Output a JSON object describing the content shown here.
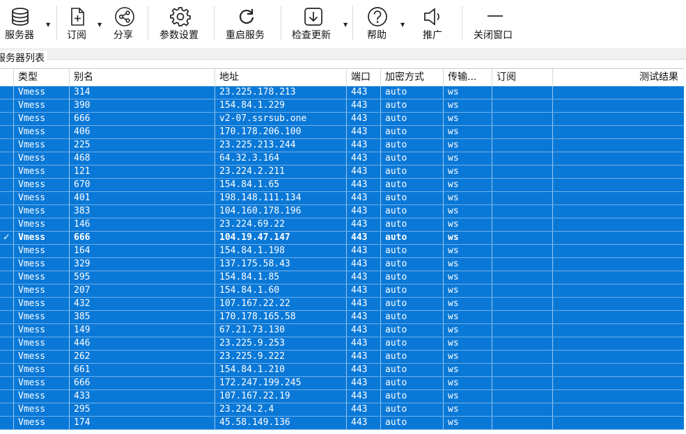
{
  "toolbar": {
    "servers": "服务器",
    "subscribe": "订阅",
    "share": "分享",
    "settings": "参数设置",
    "restart": "重启服务",
    "update": "检查更新",
    "help": "帮助",
    "promote": "推广",
    "close": "关闭窗口"
  },
  "group_label": "服务器列表",
  "columns": {
    "type": "类型",
    "alias": "别名",
    "address": "地址",
    "port": "端口",
    "security": "加密方式",
    "network": "传输...",
    "subscription": "订阅",
    "test": "测试结果"
  },
  "active_mark": "✓",
  "rows": [
    {
      "type": "Vmess",
      "alias": "314",
      "address": "23.225.178.213",
      "port": "443",
      "security": "auto",
      "network": "ws"
    },
    {
      "type": "Vmess",
      "alias": "390",
      "address": "154.84.1.229",
      "port": "443",
      "security": "auto",
      "network": "ws"
    },
    {
      "type": "Vmess",
      "alias": "666",
      "address": "v2-07.ssrsub.one",
      "port": "443",
      "security": "auto",
      "network": "ws"
    },
    {
      "type": "Vmess",
      "alias": "406",
      "address": "170.178.206.100",
      "port": "443",
      "security": "auto",
      "network": "ws"
    },
    {
      "type": "Vmess",
      "alias": "225",
      "address": "23.225.213.244",
      "port": "443",
      "security": "auto",
      "network": "ws"
    },
    {
      "type": "Vmess",
      "alias": "468",
      "address": "64.32.3.164",
      "port": "443",
      "security": "auto",
      "network": "ws"
    },
    {
      "type": "Vmess",
      "alias": "121",
      "address": "23.224.2.211",
      "port": "443",
      "security": "auto",
      "network": "ws"
    },
    {
      "type": "Vmess",
      "alias": "670",
      "address": "154.84.1.65",
      "port": "443",
      "security": "auto",
      "network": "ws"
    },
    {
      "type": "Vmess",
      "alias": "401",
      "address": "198.148.111.134",
      "port": "443",
      "security": "auto",
      "network": "ws"
    },
    {
      "type": "Vmess",
      "alias": "383",
      "address": "104.160.178.196",
      "port": "443",
      "security": "auto",
      "network": "ws"
    },
    {
      "type": "Vmess",
      "alias": "146",
      "address": "23.224.69.22",
      "port": "443",
      "security": "auto",
      "network": "ws"
    },
    {
      "type": "Vmess",
      "alias": "666",
      "address": "104.19.47.147",
      "port": "443",
      "security": "auto",
      "network": "ws",
      "active": true
    },
    {
      "type": "Vmess",
      "alias": "164",
      "address": "154.84.1.198",
      "port": "443",
      "security": "auto",
      "network": "ws"
    },
    {
      "type": "Vmess",
      "alias": "329",
      "address": "137.175.58.43",
      "port": "443",
      "security": "auto",
      "network": "ws"
    },
    {
      "type": "Vmess",
      "alias": "595",
      "address": "154.84.1.85",
      "port": "443",
      "security": "auto",
      "network": "ws"
    },
    {
      "type": "Vmess",
      "alias": "207",
      "address": "154.84.1.60",
      "port": "443",
      "security": "auto",
      "network": "ws"
    },
    {
      "type": "Vmess",
      "alias": "432",
      "address": "107.167.22.22",
      "port": "443",
      "security": "auto",
      "network": "ws"
    },
    {
      "type": "Vmess",
      "alias": "385",
      "address": "170.178.165.58",
      "port": "443",
      "security": "auto",
      "network": "ws"
    },
    {
      "type": "Vmess",
      "alias": "149",
      "address": "67.21.73.130",
      "port": "443",
      "security": "auto",
      "network": "ws"
    },
    {
      "type": "Vmess",
      "alias": "446",
      "address": "23.225.9.253",
      "port": "443",
      "security": "auto",
      "network": "ws"
    },
    {
      "type": "Vmess",
      "alias": "262",
      "address": "23.225.9.222",
      "port": "443",
      "security": "auto",
      "network": "ws"
    },
    {
      "type": "Vmess",
      "alias": "661",
      "address": "154.84.1.210",
      "port": "443",
      "security": "auto",
      "network": "ws"
    },
    {
      "type": "Vmess",
      "alias": "666",
      "address": "172.247.199.245",
      "port": "443",
      "security": "auto",
      "network": "ws"
    },
    {
      "type": "Vmess",
      "alias": "433",
      "address": "107.167.22.19",
      "port": "443",
      "security": "auto",
      "network": "ws"
    },
    {
      "type": "Vmess",
      "alias": "295",
      "address": "23.224.2.4",
      "port": "443",
      "security": "auto",
      "network": "ws"
    },
    {
      "type": "Vmess",
      "alias": "174",
      "address": "45.58.149.136",
      "port": "443",
      "security": "auto",
      "network": "ws"
    }
  ],
  "colors": {
    "selection": "#0a78d7",
    "row_line": "#6fb0ea",
    "text": "#ffffff"
  },
  "icons": {
    "servers": "database-icon",
    "subscribe": "add-file-icon",
    "share": "share-icon",
    "settings": "gear-icon",
    "restart": "refresh-icon",
    "update": "download-icon",
    "help": "help-icon",
    "promote": "speaker-icon",
    "close": "minus-icon"
  }
}
